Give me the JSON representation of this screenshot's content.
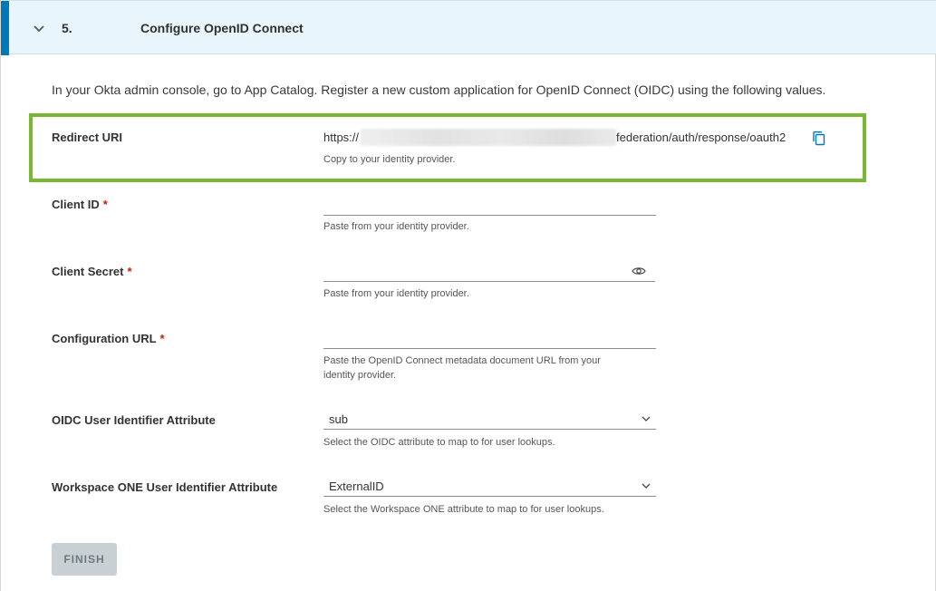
{
  "step": {
    "number": "5.",
    "title": "Configure OpenID Connect"
  },
  "intro": "In your Okta admin console, go to App Catalog. Register a new custom application for OpenID Connect (OIDC) using the following values.",
  "redirect_uri": {
    "label": "Redirect URI",
    "prefix": "https://",
    "suffix": "federation/auth/response/oauth2",
    "helper": "Copy to your identity provider.",
    "icon": "copy-icon"
  },
  "client_id": {
    "label": "Client ID",
    "required": "*",
    "value": "",
    "helper": "Paste from your identity provider."
  },
  "client_secret": {
    "label": "Client Secret",
    "required": "*",
    "value": "",
    "helper": "Paste from your identity provider.",
    "icon": "eye-icon"
  },
  "configuration_url": {
    "label": "Configuration URL",
    "required": "*",
    "value": "",
    "helper_line1": "Paste the OpenID Connect metadata document URL from your",
    "helper_line2": "identity provider."
  },
  "oidc_attribute": {
    "label": "OIDC User Identifier Attribute",
    "selected": "sub",
    "helper": "Select the OIDC attribute to map to for user lookups."
  },
  "ws1_attribute": {
    "label": "Workspace ONE User Identifier Attribute",
    "selected": "ExternalID",
    "helper": "Select the Workspace ONE attribute to map to for user lookups."
  },
  "finish_label": "FINISH",
  "colors": {
    "accent": "#0079b8",
    "highlight": "#7ab733",
    "header_bg": "#e9f5fc",
    "required": "#c92100",
    "disabled_button": "#c9d0d4"
  }
}
